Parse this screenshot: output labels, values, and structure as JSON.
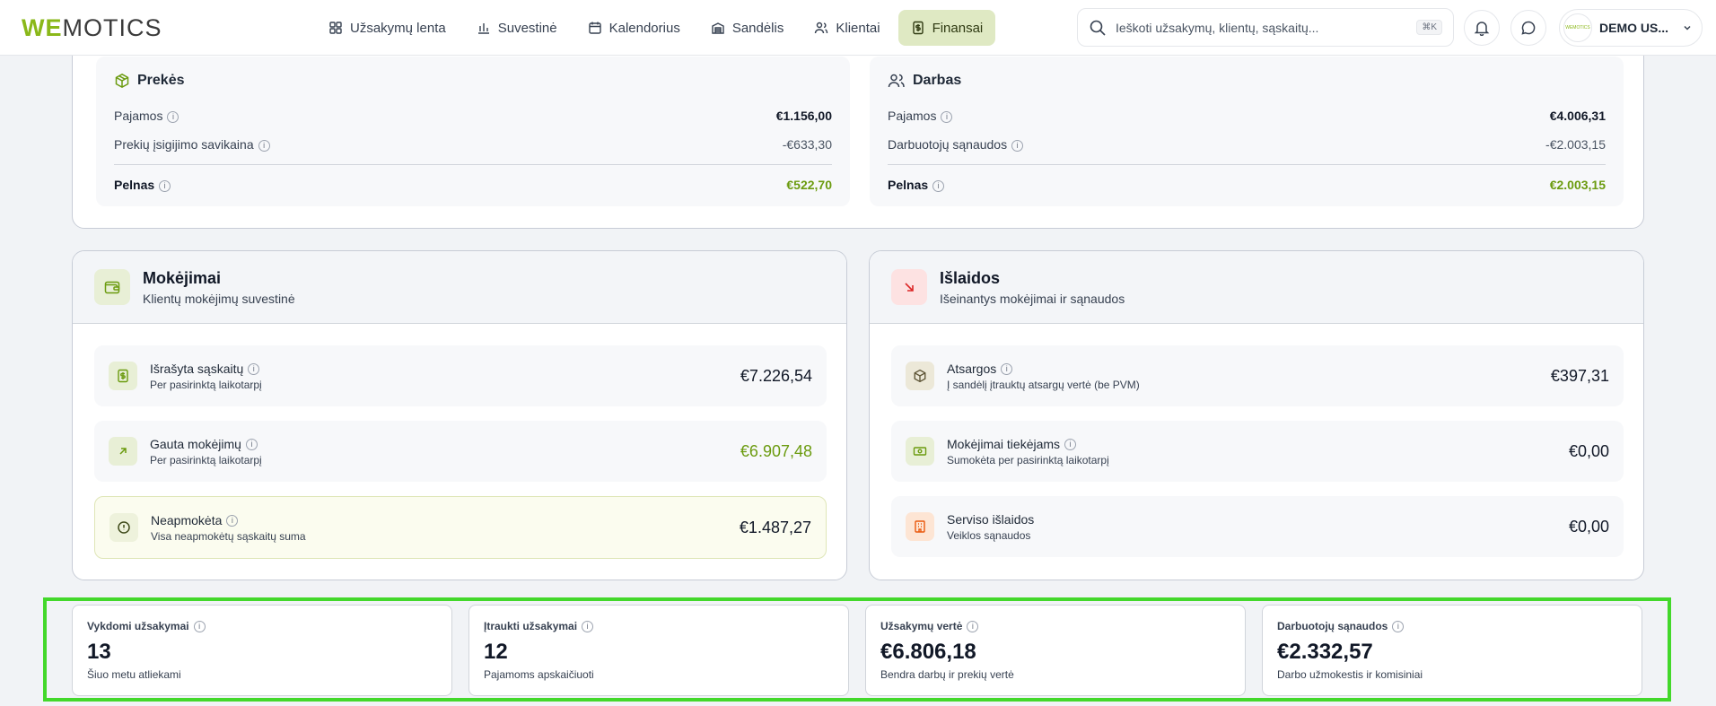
{
  "header": {
    "logo_we": "WE",
    "logo_rest": "MOTICS",
    "nav": [
      {
        "label": "Užsakymų lenta",
        "icon": "grid-icon"
      },
      {
        "label": "Suvestinė",
        "icon": "bar-chart-icon"
      },
      {
        "label": "Kalendorius",
        "icon": "calendar-icon"
      },
      {
        "label": "Sandėlis",
        "icon": "warehouse-icon"
      },
      {
        "label": "Klientai",
        "icon": "users-icon"
      },
      {
        "label": "Finansai",
        "icon": "receipt-icon",
        "active": true
      }
    ],
    "search_placeholder": "Ieškoti užsakymų, klientų, sąskaitų...",
    "search_kbd": "⌘K",
    "user_name": "DEMO US...",
    "avatar_text": "WEMOTICS"
  },
  "profit": {
    "goods": {
      "title": "Prekės",
      "income_label": "Pajamos",
      "income_value": "€1.156,00",
      "cost_label": "Prekių įsigijimo savikaina",
      "cost_value": "-€633,30",
      "profit_label": "Pelnas",
      "profit_value": "€522,70"
    },
    "work": {
      "title": "Darbas",
      "income_label": "Pajamos",
      "income_value": "€4.006,31",
      "cost_label": "Darbuotojų sąnaudos",
      "cost_value": "-€2.003,15",
      "profit_label": "Pelnas",
      "profit_value": "€2.003,15"
    }
  },
  "payments": {
    "title": "Mokėjimai",
    "subtitle": "Klientų mokėjimų suvestinė",
    "items": [
      {
        "label": "Išrašyta sąskaitų",
        "sub": "Per pasirinktą laikotarpį",
        "value": "€7.226,54"
      },
      {
        "label": "Gauta mokėjimų",
        "sub": "Per pasirinktą laikotarpį",
        "value": "€6.907,48"
      },
      {
        "label": "Neapmokėta",
        "sub": "Visa neapmokėtų sąskaitų suma",
        "value": "€1.487,27"
      }
    ]
  },
  "expenses": {
    "title": "Išlaidos",
    "subtitle": "Išeinantys mokėjimai ir sąnaudos",
    "items": [
      {
        "label": "Atsargos",
        "sub": "Į sandėlį įtrauktų atsargų vertė (be PVM)",
        "value": "€397,31"
      },
      {
        "label": "Mokėjimai tiekėjams",
        "sub": "Sumokėta per pasirinktą laikotarpį",
        "value": "€0,00"
      },
      {
        "label": "Serviso išlaidos",
        "sub": "Veiklos sąnaudos",
        "value": "€0,00"
      }
    ]
  },
  "stats": [
    {
      "label": "Vykdomi užsakymai",
      "value": "13",
      "sub": "Šiuo metu atliekami"
    },
    {
      "label": "Įtraukti užsakymai",
      "value": "12",
      "sub": "Pajamoms apskaičiuoti"
    },
    {
      "label": "Užsakymų vertė",
      "value": "€6.806,18",
      "sub": "Bendra darbų ir prekių vertė"
    },
    {
      "label": "Darbuotojų sąnaudos",
      "value": "€2.332,57",
      "sub": "Darbo užmokestis ir komisiniai"
    }
  ],
  "colors": {
    "accent": "#8ab819",
    "accent_text": "#6b9b0f",
    "highlight_border": "#43d82b",
    "expense_icon_bg": "#fde2e2"
  }
}
